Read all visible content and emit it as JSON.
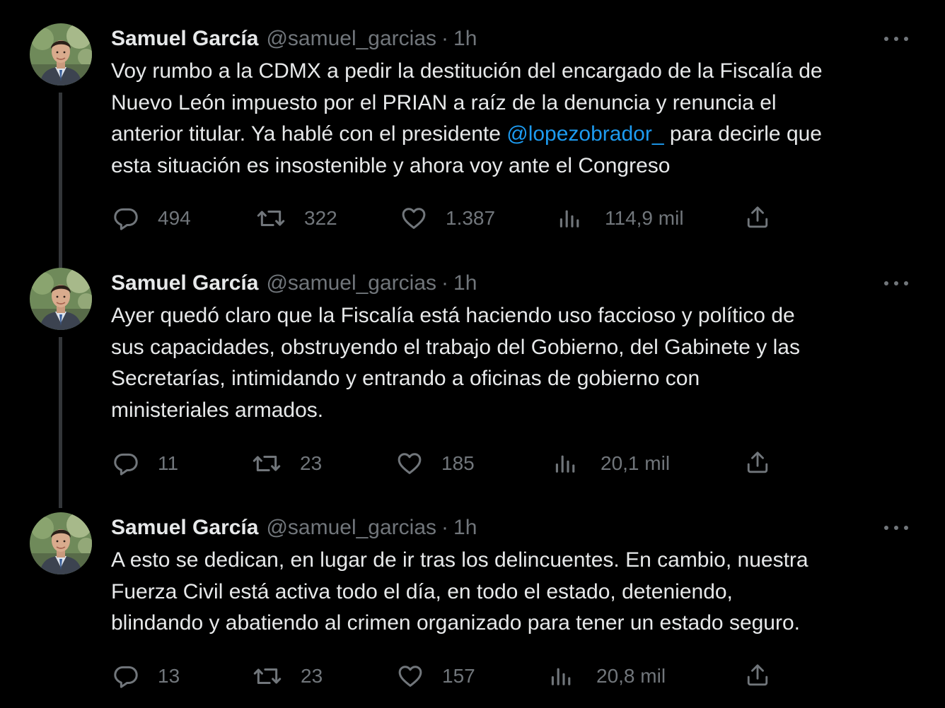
{
  "tweets": [
    {
      "name": "Samuel García",
      "handle": "@samuel_garcias",
      "separator": "·",
      "time": "1h",
      "lines": [
        [
          {
            "t": "Voy rumbo a la CDMX a pedir la destitución del encargado de la Fiscalía de"
          }
        ],
        [
          {
            "t": "Nuevo León impuesto por el PRIAN a raíz de la denuncia y renuncia el"
          }
        ],
        [
          {
            "t": "anterior titular. Ya hablé con el presidente "
          },
          {
            "t": "@lopezobrador_",
            "mention": true
          },
          {
            "t": " para decirle que"
          }
        ],
        [
          {
            "t": "esta situación es insostenible y ahora voy ante el Congreso"
          }
        ]
      ],
      "replies": "494",
      "retweets": "322",
      "likes": "1.387",
      "views": "114,9 mil"
    },
    {
      "name": "Samuel García",
      "handle": "@samuel_garcias",
      "separator": "·",
      "time": "1h",
      "lines": [
        [
          {
            "t": "Ayer quedó claro que la Fiscalía está haciendo uso faccioso y político de"
          }
        ],
        [
          {
            "t": "sus capacidades, obstruyendo el trabajo del Gobierno, del Gabinete y las"
          }
        ],
        [
          {
            "t": "Secretarías, intimidando y entrando a oficinas de gobierno con"
          }
        ],
        [
          {
            "t": "ministeriales armados."
          }
        ]
      ],
      "replies": "11",
      "retweets": "23",
      "likes": "185",
      "views": "20,1 mil"
    },
    {
      "name": "Samuel García",
      "handle": "@samuel_garcias",
      "separator": "·",
      "time": "1h",
      "lines": [
        [
          {
            "t": "A esto se dedican, en lugar de ir tras los delincuentes. En cambio, nuestra"
          }
        ],
        [
          {
            "t": "Fuerza Civil está activa todo el día, en todo el estado, deteniendo,"
          }
        ],
        [
          {
            "t": "blindando y abatiendo al crimen organizado para tener un estado seguro."
          }
        ]
      ],
      "replies": "13",
      "retweets": "23",
      "likes": "157",
      "views": "20,8 mil"
    }
  ],
  "icons": {
    "reply": "reply-icon",
    "retweet": "retweet-icon",
    "like": "like-icon",
    "views": "views-icon",
    "share": "share-icon",
    "more": "more-icon"
  },
  "colors": {
    "background": "#000000",
    "text": "#e7e9ea",
    "secondary": "#71767b",
    "mention": "#1d9bf0",
    "thread_line": "#333639"
  }
}
